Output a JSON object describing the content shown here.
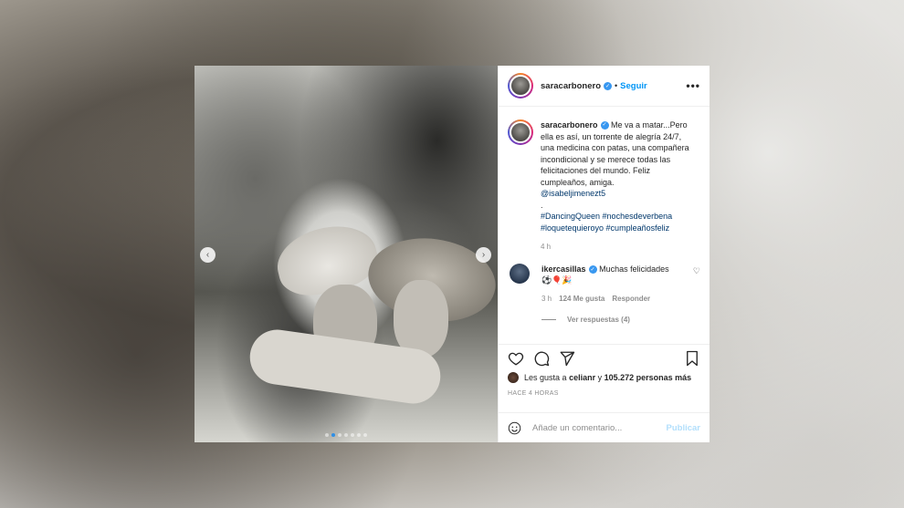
{
  "post": {
    "username": "saracarbonero",
    "follow_label": "Seguir",
    "separator": "•",
    "more_label": "•••",
    "caption": {
      "username": "saracarbonero",
      "text": "Me va a matar...Pero ella es así, un torrente de alegría 24/7, una medicina con patas, una compañera incondicional y se merece todas las felicitaciones del mundo. Feliz cumpleaños, amiga.",
      "mention": "@isabeljimenezt5",
      "dot": ".",
      "hashtags_line1": "#DancingQueen #nochesdeverbena",
      "hashtags_line2": "#loquetequieroyo #cumpleañosfeliz",
      "time": "4 h"
    },
    "comment": {
      "username": "ikercasillas",
      "text": "Muchas felicidades",
      "emojis": "⚽🎈🎉",
      "time": "3 h",
      "likes": "124 Me gusta",
      "reply_label": "Responder",
      "view_replies": "Ver respuestas (4)"
    },
    "likes": {
      "prefix": "Les gusta a",
      "user": "celianr",
      "connector": "y",
      "others": "105.272 personas más"
    },
    "posted_time": "HACE 4 HORAS",
    "add_comment": {
      "placeholder": "Añade un comentario...",
      "publish_label": "Publicar"
    },
    "carousel": {
      "prev": "‹",
      "next": "›",
      "slides": 7,
      "active": 1
    }
  },
  "colors": {
    "accent": "#0095f6",
    "verified": "#3897f0",
    "publish_disabled": "#b2dffc",
    "carousel_active_dot": "#2f8fe6"
  }
}
